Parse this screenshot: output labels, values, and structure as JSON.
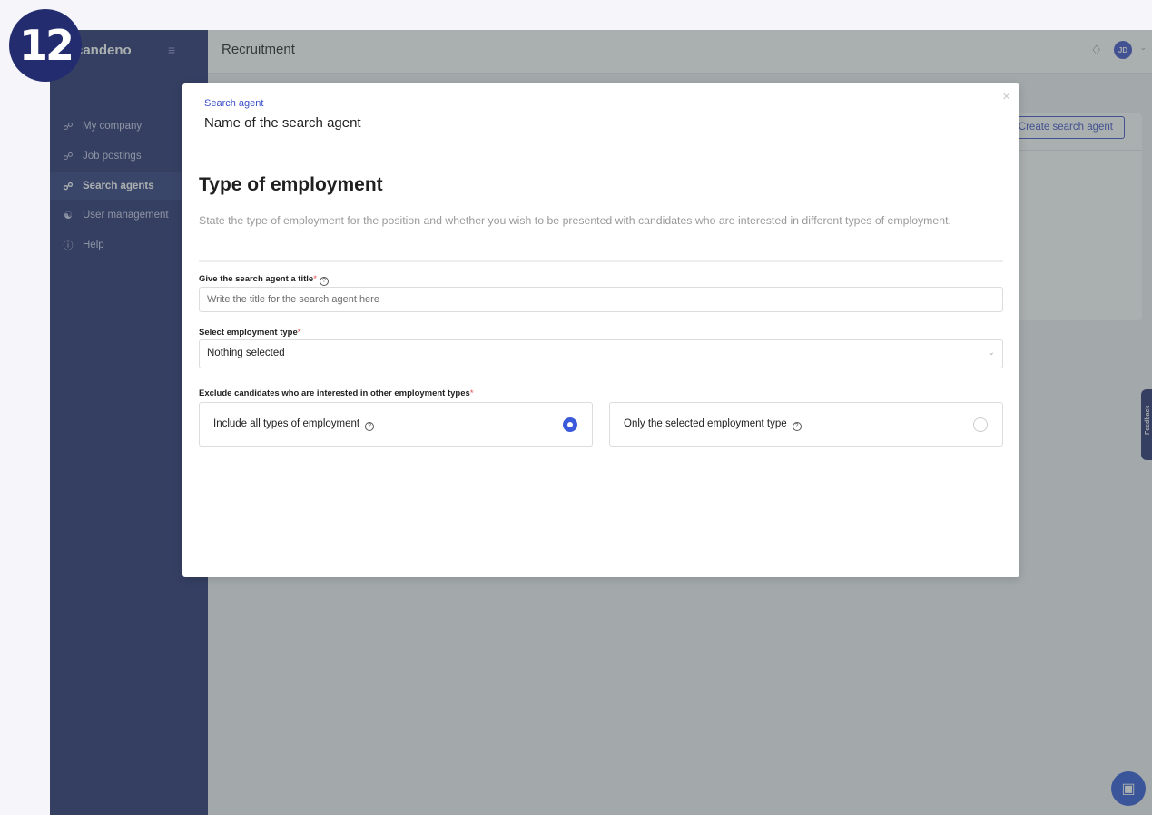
{
  "step_badge": "12",
  "app": {
    "brand": "candeno",
    "sidebar": {
      "items": [
        {
          "label": "My company",
          "icon": "link-icon"
        },
        {
          "label": "Job postings",
          "icon": "link-icon"
        },
        {
          "label": "Search agents",
          "icon": "link-icon",
          "active": true
        },
        {
          "label": "User management",
          "icon": "users-icon"
        },
        {
          "label": "Help",
          "icon": "help-circle-icon"
        }
      ]
    },
    "topbar": {
      "title": "Recruitment",
      "avatar_initials": "JD"
    },
    "main": {
      "create_button": "Create search agent"
    },
    "feedback_label": "Feedback"
  },
  "modal": {
    "breadcrumb": "Search agent",
    "agent_name": "Name of the search agent",
    "heading": "Type of employment",
    "description": "State the type of employment for the position and whether you wish to be presented with candidates who are interested in different types of employment.",
    "title_field": {
      "label": "Give the search agent a title",
      "required_mark": "*",
      "placeholder": "Write the title for the search agent here",
      "value": ""
    },
    "employment_type_field": {
      "label": "Select employment type",
      "required_mark": "*",
      "selected": "Nothing selected"
    },
    "exclude_field": {
      "label": "Exclude candidates who are interested in other employment types",
      "required_mark": "*",
      "options": [
        {
          "label": "Include all types of employment",
          "selected": true
        },
        {
          "label": "Only the selected employment type",
          "selected": false
        }
      ]
    }
  },
  "colors": {
    "sidebar": "#232c6e",
    "accent": "#3b5bdb",
    "required": "#e04848"
  }
}
